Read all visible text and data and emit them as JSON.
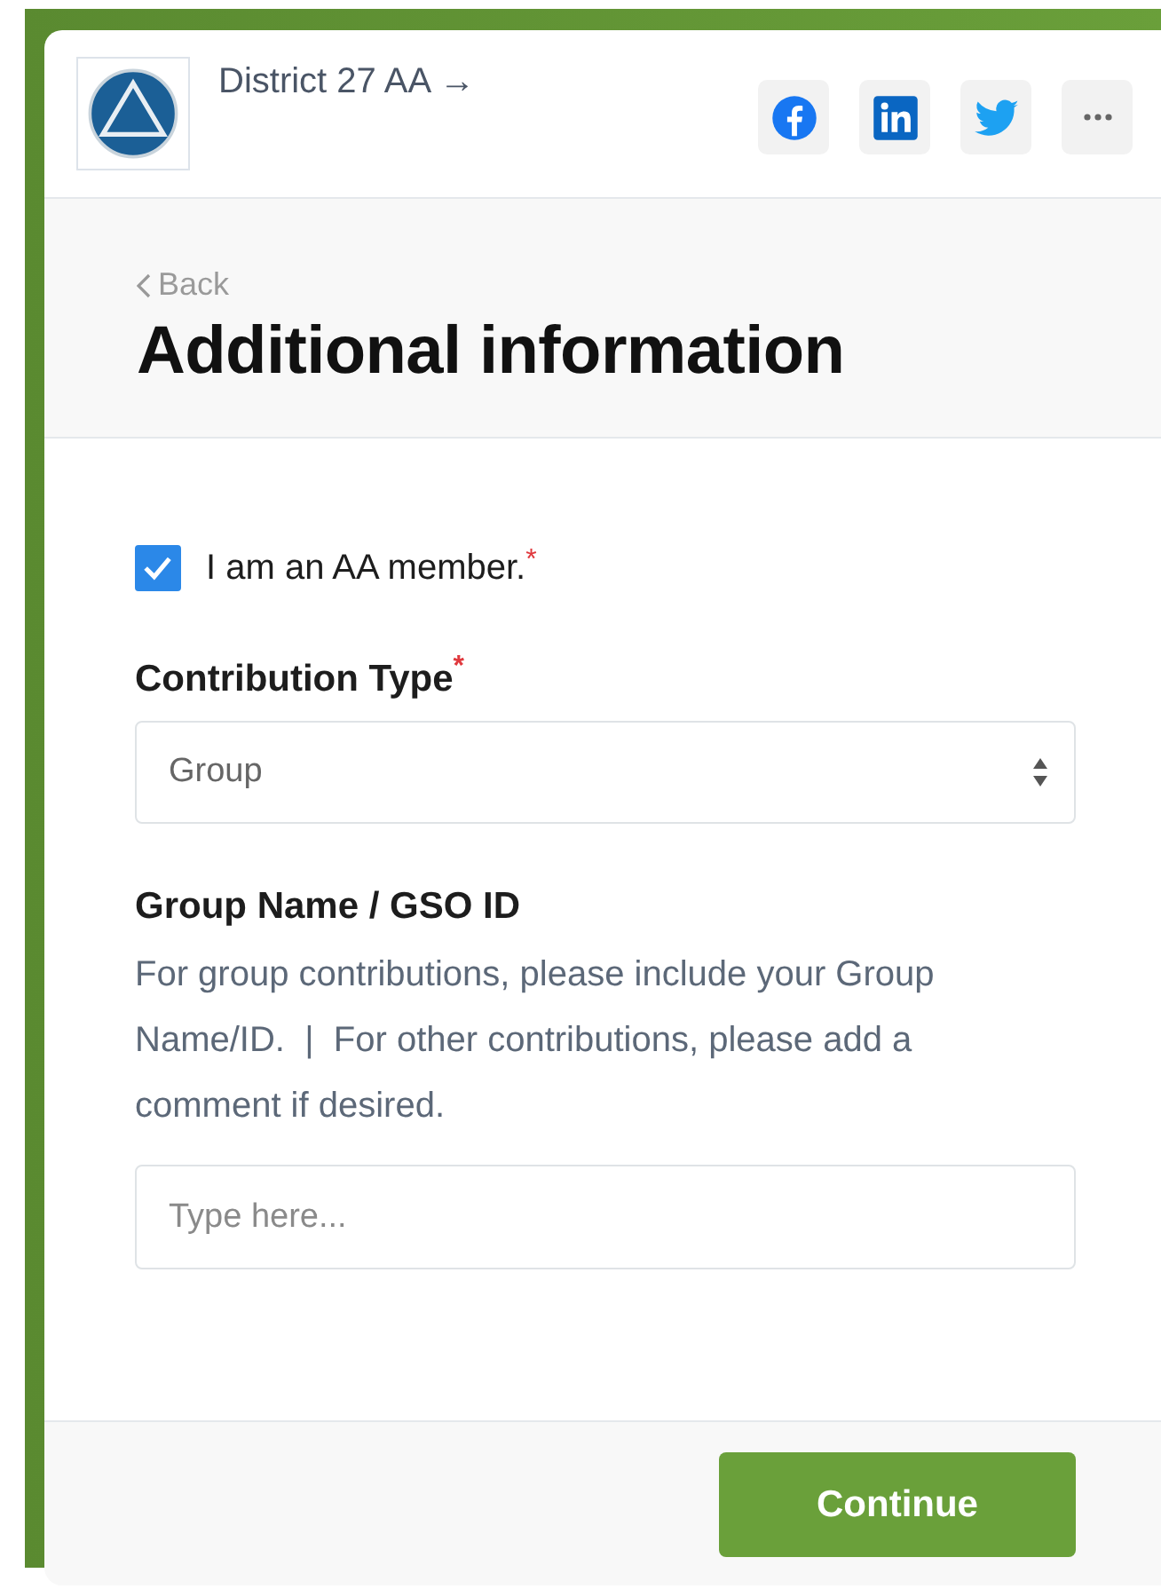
{
  "header": {
    "org_name": "District 27 AA",
    "arrow": "→",
    "share_buttons": [
      {
        "kind": "facebook"
      },
      {
        "kind": "linkedin"
      },
      {
        "kind": "twitter"
      },
      {
        "kind": "more"
      }
    ]
  },
  "page": {
    "back": "Back",
    "title": "Additional information"
  },
  "form": {
    "member_checkbox": {
      "label": "I am an AA member.",
      "checked": true,
      "required_mark": "*"
    },
    "contribution_type": {
      "label": "Contribution Type",
      "required_mark": "*",
      "value": "Group"
    },
    "group_name": {
      "label": "Group Name / GSO ID",
      "help": "For group contributions, please include your Group Name/ID.  |  For other contributions, please add a comment if desired.",
      "placeholder": "Type here..."
    }
  },
  "footer": {
    "button": "Continue"
  }
}
